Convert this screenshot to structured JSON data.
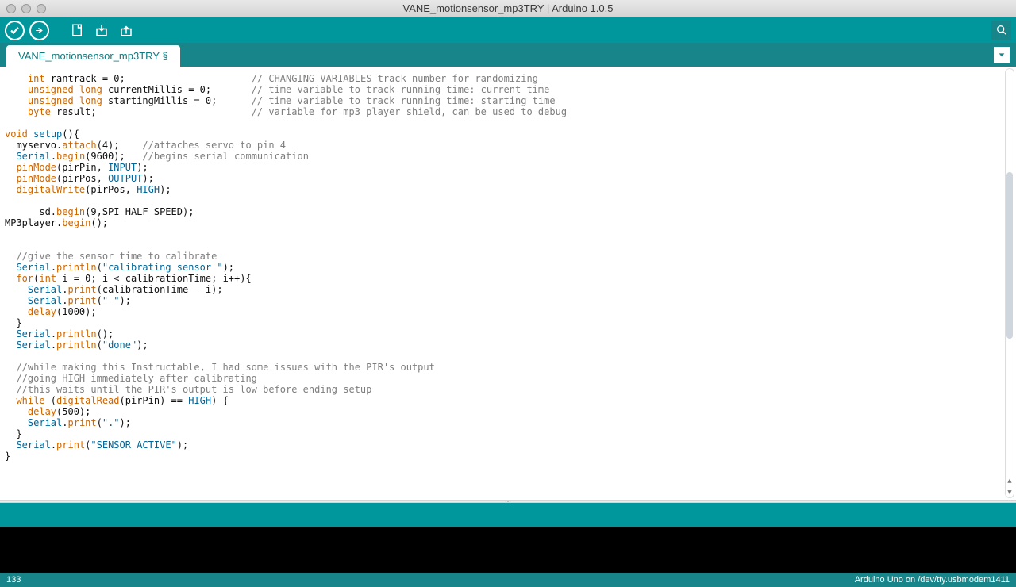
{
  "window": {
    "title": "VANE_motionsensor_mp3TRY | Arduino 1.0.5"
  },
  "toolbar": {
    "verify_tip": "Verify",
    "upload_tip": "Upload",
    "new_tip": "New",
    "open_tip": "Open",
    "save_tip": "Save",
    "serial_tip": "Serial Monitor"
  },
  "tab": {
    "label": "VANE_motionsensor_mp3TRY §"
  },
  "status": {
    "line": "133",
    "board": "Arduino Uno on /dev/tty.usbmodem1411"
  },
  "code": {
    "tokens": [
      [
        [
          "pad",
          "    "
        ],
        [
          "type",
          "int"
        ],
        [
          "plain",
          " rantrack = 0;"
        ],
        [
          "padto",
          43
        ],
        [
          "comment",
          "// CHANGING VARIABLES track number for randomizing"
        ]
      ],
      [
        [
          "pad",
          "    "
        ],
        [
          "type",
          "unsigned long"
        ],
        [
          "plain",
          " currentMillis = 0;"
        ],
        [
          "padto",
          43
        ],
        [
          "comment",
          "// time variable to track running time: current time"
        ]
      ],
      [
        [
          "pad",
          "    "
        ],
        [
          "type",
          "unsigned long"
        ],
        [
          "plain",
          " startingMillis = 0;"
        ],
        [
          "padto",
          43
        ],
        [
          "comment",
          "// time variable to track running time: starting time"
        ]
      ],
      [
        [
          "pad",
          "    "
        ],
        [
          "type",
          "byte"
        ],
        [
          "plain",
          " result;"
        ],
        [
          "padto",
          43
        ],
        [
          "comment",
          "// variable for mp3 player shield, can be used to debug"
        ]
      ],
      [],
      [
        [
          "type",
          "void"
        ],
        [
          "plain",
          " "
        ],
        [
          "const",
          "setup"
        ],
        [
          "plain",
          "(){"
        ]
      ],
      [
        [
          "pad",
          "  "
        ],
        [
          "plain",
          "myservo."
        ],
        [
          "func",
          "attach"
        ],
        [
          "plain",
          "(4);    "
        ],
        [
          "comment",
          "//attaches servo to pin 4"
        ]
      ],
      [
        [
          "pad",
          "  "
        ],
        [
          "const",
          "Serial"
        ],
        [
          "plain",
          "."
        ],
        [
          "func",
          "begin"
        ],
        [
          "plain",
          "(9600);   "
        ],
        [
          "comment",
          "//begins serial communication"
        ]
      ],
      [
        [
          "pad",
          "  "
        ],
        [
          "func",
          "pinMode"
        ],
        [
          "plain",
          "(pirPin, "
        ],
        [
          "const",
          "INPUT"
        ],
        [
          "plain",
          ");"
        ]
      ],
      [
        [
          "pad",
          "  "
        ],
        [
          "func",
          "pinMode"
        ],
        [
          "plain",
          "(pirPos, "
        ],
        [
          "const",
          "OUTPUT"
        ],
        [
          "plain",
          ");"
        ]
      ],
      [
        [
          "pad",
          "  "
        ],
        [
          "func",
          "digitalWrite"
        ],
        [
          "plain",
          "(pirPos, "
        ],
        [
          "const",
          "HIGH"
        ],
        [
          "plain",
          ");"
        ]
      ],
      [],
      [
        [
          "pad",
          "      "
        ],
        [
          "plain",
          "sd."
        ],
        [
          "func",
          "begin"
        ],
        [
          "plain",
          "(9,SPI_HALF_SPEED);"
        ]
      ],
      [
        [
          "plain",
          "MP3player."
        ],
        [
          "func",
          "begin"
        ],
        [
          "plain",
          "();"
        ]
      ],
      [],
      [],
      [
        [
          "pad",
          "  "
        ],
        [
          "comment",
          "//give the sensor time to calibrate"
        ]
      ],
      [
        [
          "pad",
          "  "
        ],
        [
          "const",
          "Serial"
        ],
        [
          "plain",
          "."
        ],
        [
          "func",
          "println"
        ],
        [
          "plain",
          "("
        ],
        [
          "string",
          "\"calibrating sensor \""
        ],
        [
          "plain",
          ");"
        ]
      ],
      [
        [
          "pad",
          "  "
        ],
        [
          "keyword",
          "for"
        ],
        [
          "plain",
          "("
        ],
        [
          "type",
          "int"
        ],
        [
          "plain",
          " i = 0; i < calibrationTime; i++){"
        ]
      ],
      [
        [
          "pad",
          "    "
        ],
        [
          "const",
          "Serial"
        ],
        [
          "plain",
          "."
        ],
        [
          "func",
          "print"
        ],
        [
          "plain",
          "(calibrationTime - i);"
        ]
      ],
      [
        [
          "pad",
          "    "
        ],
        [
          "const",
          "Serial"
        ],
        [
          "plain",
          "."
        ],
        [
          "func",
          "print"
        ],
        [
          "plain",
          "("
        ],
        [
          "string",
          "\"-\""
        ],
        [
          "plain",
          ");"
        ]
      ],
      [
        [
          "pad",
          "    "
        ],
        [
          "func",
          "delay"
        ],
        [
          "plain",
          "(1000);"
        ]
      ],
      [
        [
          "pad",
          "  "
        ],
        [
          "plain",
          "}"
        ]
      ],
      [
        [
          "pad",
          "  "
        ],
        [
          "const",
          "Serial"
        ],
        [
          "plain",
          "."
        ],
        [
          "func",
          "println"
        ],
        [
          "plain",
          "();"
        ]
      ],
      [
        [
          "pad",
          "  "
        ],
        [
          "const",
          "Serial"
        ],
        [
          "plain",
          "."
        ],
        [
          "func",
          "println"
        ],
        [
          "plain",
          "("
        ],
        [
          "string",
          "\"done\""
        ],
        [
          "plain",
          ");"
        ]
      ],
      [],
      [
        [
          "pad",
          "  "
        ],
        [
          "comment",
          "//while making this Instructable, I had some issues with the PIR's output"
        ]
      ],
      [
        [
          "pad",
          "  "
        ],
        [
          "comment",
          "//going HIGH immediately after calibrating"
        ]
      ],
      [
        [
          "pad",
          "  "
        ],
        [
          "comment",
          "//this waits until the PIR's output is low before ending setup"
        ]
      ],
      [
        [
          "pad",
          "  "
        ],
        [
          "keyword",
          "while"
        ],
        [
          "plain",
          " ("
        ],
        [
          "func",
          "digitalRead"
        ],
        [
          "plain",
          "(pirPin) == "
        ],
        [
          "const",
          "HIGH"
        ],
        [
          "plain",
          ") {"
        ]
      ],
      [
        [
          "pad",
          "    "
        ],
        [
          "func",
          "delay"
        ],
        [
          "plain",
          "(500);"
        ]
      ],
      [
        [
          "pad",
          "    "
        ],
        [
          "const",
          "Serial"
        ],
        [
          "plain",
          "."
        ],
        [
          "func",
          "print"
        ],
        [
          "plain",
          "("
        ],
        [
          "string",
          "\".\""
        ],
        [
          "plain",
          ");"
        ]
      ],
      [
        [
          "pad",
          "  "
        ],
        [
          "plain",
          "}"
        ]
      ],
      [
        [
          "pad",
          "  "
        ],
        [
          "const",
          "Serial"
        ],
        [
          "plain",
          "."
        ],
        [
          "func",
          "print"
        ],
        [
          "plain",
          "("
        ],
        [
          "string",
          "\"SENSOR ACTIVE\""
        ],
        [
          "plain",
          ");"
        ]
      ],
      [
        [
          "plain",
          "}"
        ]
      ]
    ]
  }
}
